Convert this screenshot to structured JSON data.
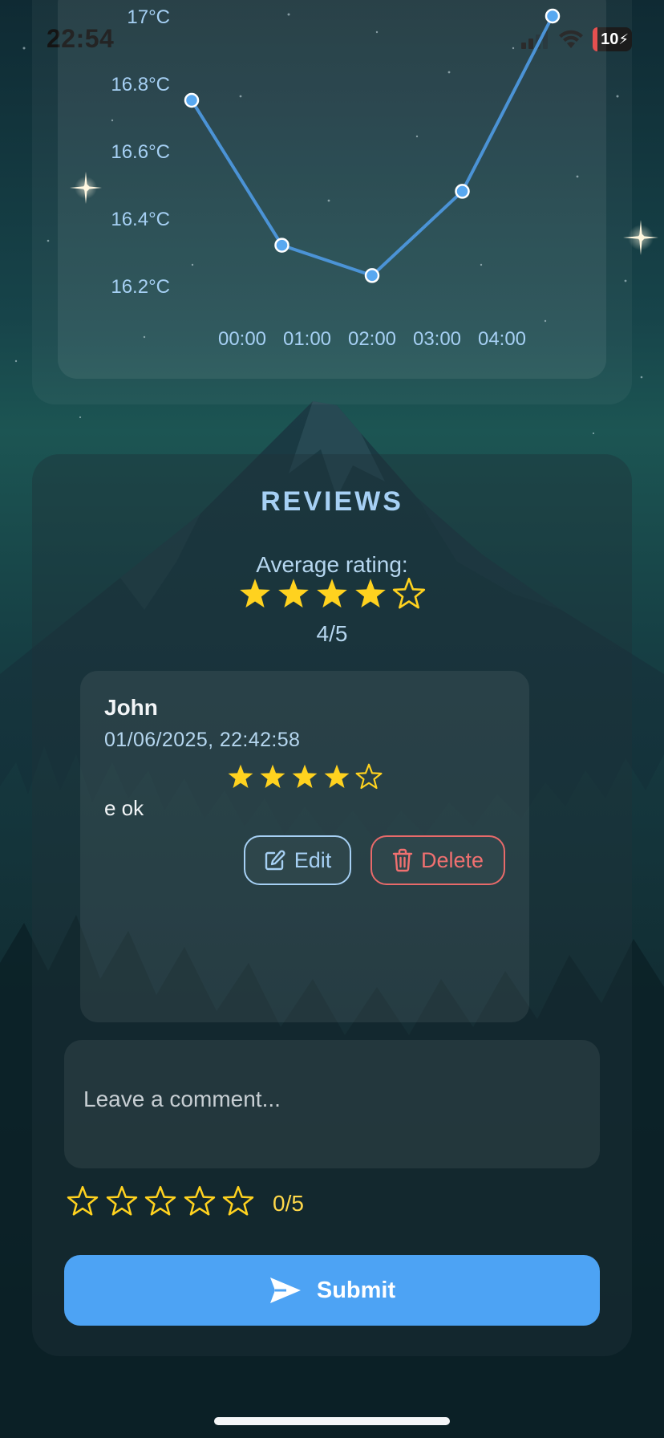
{
  "status_bar": {
    "time": "22:54",
    "battery": "10"
  },
  "temperature_chart": {
    "chart_data": {
      "type": "line",
      "x": [
        "00:00",
        "01:00",
        "02:00",
        "03:00",
        "04:00"
      ],
      "series": [
        {
          "values": [
            16.75,
            16.32,
            16.23,
            16.48,
            17.0
          ]
        }
      ],
      "y_ticks": [
        "17°C",
        "16.8°C",
        "16.6°C",
        "16.4°C",
        "16.2°C"
      ],
      "ylim": [
        16.2,
        17.0
      ],
      "grid": false,
      "color": "#4b93d6",
      "marker_color": "#58a8f0"
    }
  },
  "reviews": {
    "title": "REVIEWS",
    "average_label": "Average rating:",
    "average_rating": 4,
    "max_rating": 5,
    "average_score_text": "4/5",
    "items": [
      {
        "author": "John",
        "date": "01/06/2025, 22:42:58",
        "rating": 4,
        "text": "e ok",
        "edit_label": "Edit",
        "delete_label": "Delete"
      }
    ]
  },
  "new_review": {
    "placeholder": "Leave a comment...",
    "rating": 0,
    "score_text": "0/5",
    "submit_label": "Submit"
  },
  "colors": {
    "star": "#ffd21f",
    "accent": "#4da3f4",
    "danger": "#e86a6a",
    "title": "#a6d0f4"
  }
}
